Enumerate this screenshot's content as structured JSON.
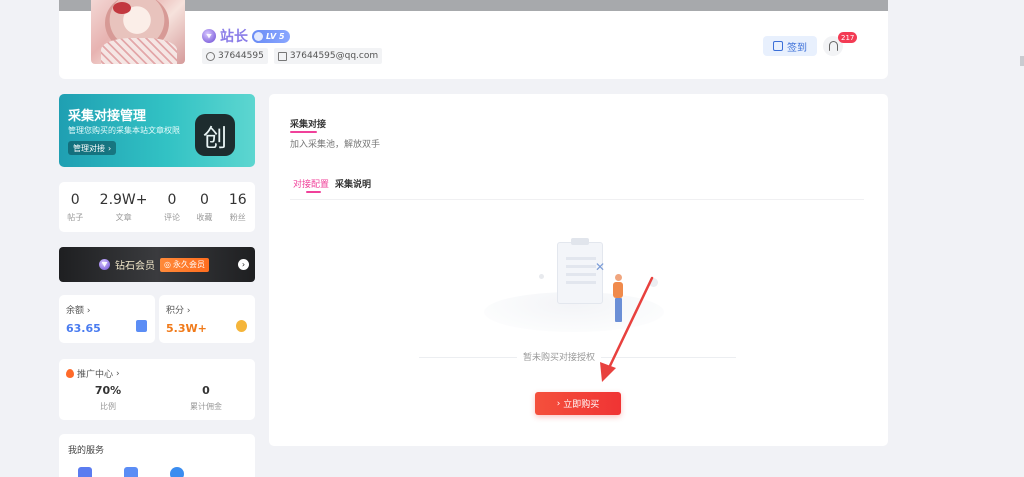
{
  "profile": {
    "username": "站长",
    "level": "LV 5",
    "uid": "37644595",
    "email": "37644595@qq.com",
    "checkin_label": "签到",
    "notification_count": "217"
  },
  "sidebar": {
    "promo": {
      "title": "采集对接管理",
      "subtitle": "管理您购买的采集本站文章权限",
      "button_label": "管理对接",
      "logo_glyph": "创"
    },
    "stats": [
      {
        "value": "0",
        "label": "帖子"
      },
      {
        "value": "2.9W+",
        "label": "文章"
      },
      {
        "value": "0",
        "label": "评论"
      },
      {
        "value": "0",
        "label": "收藏"
      },
      {
        "value": "16",
        "label": "粉丝"
      }
    ],
    "vip": {
      "label": "钻石会员",
      "tag": "永久会员"
    },
    "balance": {
      "label": "余额",
      "value": "63.65",
      "color": "#4a7cf0"
    },
    "points": {
      "label": "积分",
      "value": "5.3W+",
      "color": "#f07a1a"
    },
    "promotion_center": {
      "label": "推广中心",
      "items": [
        {
          "value": "70%",
          "label": "比例"
        },
        {
          "value": "0",
          "label": "累计佣金"
        }
      ]
    },
    "services": {
      "title": "我的服务"
    }
  },
  "main": {
    "section_title": "采集对接",
    "section_subtitle": "加入采集池，解放双手",
    "tabs": [
      {
        "label": "对接配置",
        "active": true
      },
      {
        "label": "采集说明",
        "active": false
      }
    ],
    "empty_text": "暂未购买对接授权",
    "buy_button_label": "立即购买",
    "accent_color": "#f0419a"
  }
}
